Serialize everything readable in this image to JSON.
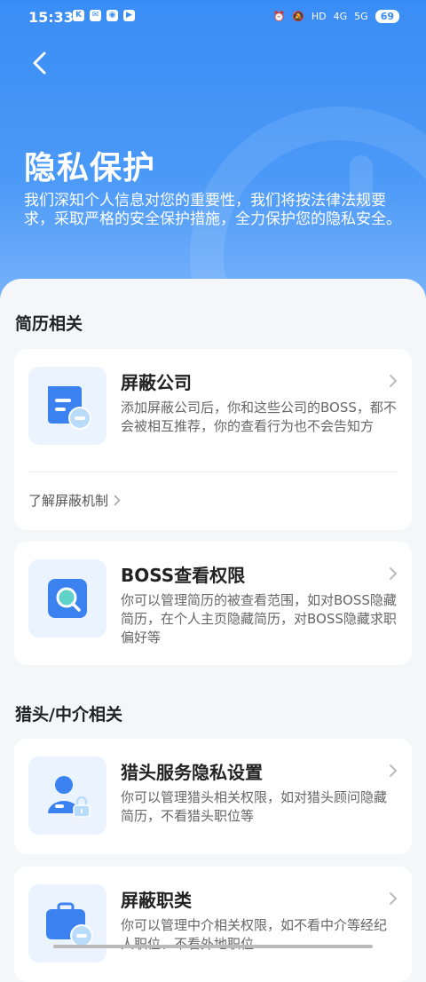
{
  "status_bar": {
    "time": "15:33",
    "app_icons": [
      "k-icon",
      "mail-icon",
      "weibo-icon",
      "play-icon"
    ],
    "right_labels": [
      "HD",
      "4G",
      "5G"
    ],
    "battery": "69"
  },
  "header": {
    "title": "隐私保护",
    "description": "我们深知个人信息对您的重要性，我们将按法律法规要求，采取严格的安全保护措施，全力保护您的隐私安全。"
  },
  "sections": {
    "resume": {
      "title": "简历相关"
    },
    "headhunter": {
      "title": "猎头/中介相关"
    }
  },
  "cards": {
    "block_company": {
      "title": "屏蔽公司",
      "desc": "添加屏蔽公司后，你和这些公司的BOSS，都不会被相互推荐，你的查看行为也不会告知方",
      "link": "了解屏蔽机制"
    },
    "boss_view": {
      "title": "BOSS查看权限",
      "desc": "你可以管理简历的被查看范围，如对BOSS隐藏简历，在个人主页隐藏简历，对BOSS隐藏求职偏好等"
    },
    "headhunter_privacy": {
      "title": "猎头服务隐私设置",
      "desc": "你可以管理猎头相关权限，如对猎头顾问隐藏简历，不看猎头职位等"
    },
    "block_jobs": {
      "title": "屏蔽职类",
      "desc": "你可以管理中介相关权限，如不看中介等经纪人职位、不看外地职位"
    }
  },
  "colors": {
    "brand_blue": "#3a8df5",
    "icon_blue": "#3b82f0",
    "icon_teal": "#5fd3c8"
  }
}
